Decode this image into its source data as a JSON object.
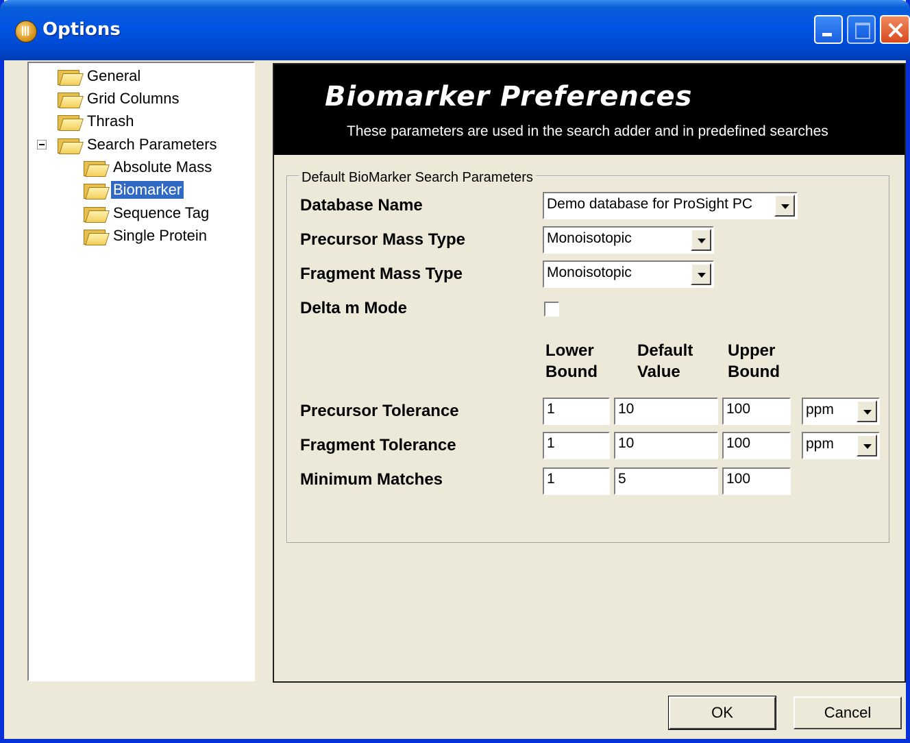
{
  "window": {
    "title": "Options"
  },
  "tree": {
    "items": [
      {
        "label": "General"
      },
      {
        "label": "Grid Columns"
      },
      {
        "label": "Thrash"
      },
      {
        "label": "Search Parameters"
      },
      {
        "label": "Absolute Mass"
      },
      {
        "label": "Biomarker"
      },
      {
        "label": "Sequence Tag"
      },
      {
        "label": "Single Protein"
      }
    ],
    "selected": "Biomarker"
  },
  "header": {
    "title": "Biomarker Preferences",
    "subtitle": "These parameters are used in the search adder and in predefined searches"
  },
  "group": {
    "legend": "Default BioMarker Search Parameters",
    "database_name": {
      "label": "Database Name",
      "value": "Demo database for ProSight PC"
    },
    "precursor_mass_type": {
      "label": "Precursor Mass Type",
      "value": "Monoisotopic"
    },
    "fragment_mass_type": {
      "label": "Fragment Mass Type",
      "value": "Monoisotopic"
    },
    "delta_m_mode": {
      "label": "Delta m Mode",
      "checked": false
    },
    "columns": {
      "lower_line1": "Lower",
      "lower_line2": "Bound",
      "default_line1": "Default",
      "default_line2": "Value",
      "upper_line1": "Upper",
      "upper_line2": "Bound"
    },
    "precursor_tolerance": {
      "label": "Precursor Tolerance",
      "lower": "1",
      "default": "10",
      "upper": "100",
      "unit": "ppm"
    },
    "fragment_tolerance": {
      "label": "Fragment Tolerance",
      "lower": "1",
      "default": "10",
      "upper": "100",
      "unit": "ppm"
    },
    "minimum_matches": {
      "label": "Minimum Matches",
      "lower": "1",
      "default": "5",
      "upper": "100"
    }
  },
  "buttons": {
    "ok": "OK",
    "cancel": "Cancel"
  }
}
